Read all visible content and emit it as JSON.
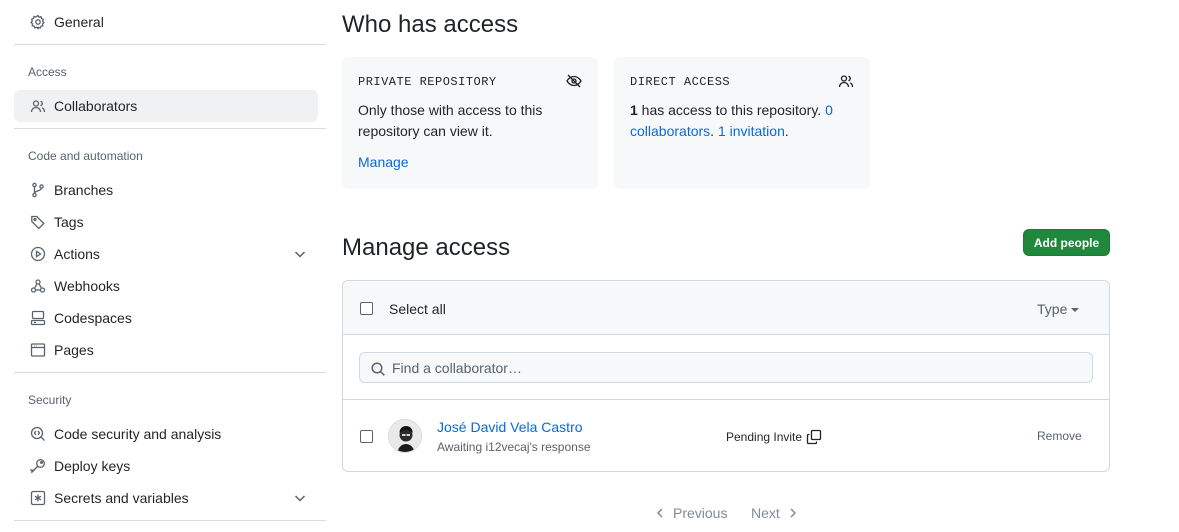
{
  "sidebar": {
    "general": "General",
    "groups": {
      "access": "Access",
      "code": "Code and automation",
      "security": "Security"
    },
    "items": {
      "collaborators": "Collaborators",
      "branches": "Branches",
      "tags": "Tags",
      "actions": "Actions",
      "webhooks": "Webhooks",
      "codespaces": "Codespaces",
      "pages": "Pages",
      "code_security": "Code security and analysis",
      "deploy_keys": "Deploy keys",
      "secrets": "Secrets and variables"
    },
    "icons": [
      "gear-icon",
      "people-icon",
      "git-branch-icon",
      "tag-icon",
      "play-icon",
      "webhook-icon",
      "codespaces-icon",
      "browser-icon",
      "codescan-icon",
      "key-icon",
      "asterisk-icon",
      "chevron-down-icon"
    ]
  },
  "who_has_access": {
    "title": "Who has access",
    "private_card": {
      "kicker": "PRIVATE REPOSITORY",
      "text": "Only those with access to this repository can view it.",
      "manage": "Manage"
    },
    "direct_card": {
      "kicker": "DIRECT ACCESS",
      "count": "1",
      "text_a": " has access to this repository. ",
      "collaborators_link": "0 collaborators",
      "sep": ". ",
      "invitation_link": "1 invitation",
      "end": "."
    }
  },
  "manage_access": {
    "title": "Manage access",
    "add_button": "Add people",
    "select_all": "Select all",
    "type_filter": "Type",
    "search_placeholder": "Find a collaborator…",
    "members": [
      {
        "name": "José David Vela Castro",
        "subtitle": "Awaiting i12vecaj's response",
        "status": "Pending Invite",
        "action": "Remove"
      }
    ]
  },
  "pagination": {
    "previous": "Previous",
    "next": "Next"
  },
  "colors": {
    "accent": "#0969da",
    "primary_button": "#1f883d",
    "muted": "#59636e",
    "card_bg": "#f6f8fa"
  }
}
